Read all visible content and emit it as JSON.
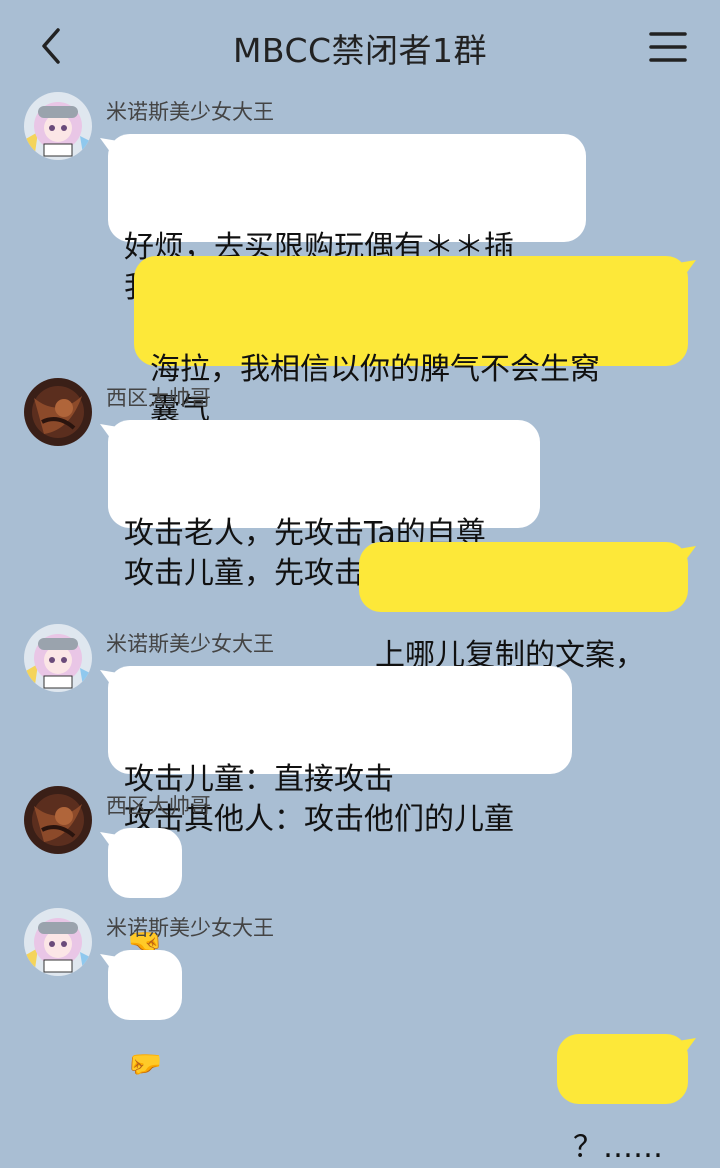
{
  "header": {
    "title": "MBCC禁闭者1群",
    "back_icon": "chevron-left-icon",
    "menu_icon": "hamburger-menu-icon"
  },
  "colors": {
    "background": "#a9bed3",
    "incoming_bubble": "#ffffff",
    "outgoing_bubble": "#fde839"
  },
  "messages": [
    {
      "sender": "米诺斯美少女大王",
      "text": "好烦，去买限购玩偶有＊＊插\n我们的队【此消息已优化】"
    },
    {
      "sender": "me",
      "text": "海拉，我相信以你的脾气不会生窝\n囊气"
    },
    {
      "sender": "西区大帅哥",
      "text": "攻击老人，先攻击Ta的自尊\n攻击儿童，先攻击Ta的天真"
    },
    {
      "sender": "me",
      "text": "上哪儿复制的文案，"
    },
    {
      "sender": "米诺斯美少女大王",
      "text": "攻击儿童：直接攻击\n攻击其他人：攻击他们的儿童"
    },
    {
      "sender": "西区大帅哥",
      "text": "🤜"
    },
    {
      "sender": "米诺斯美少女大王",
      "text": "🤛"
    },
    {
      "sender": "me",
      "text": "？……"
    }
  ]
}
